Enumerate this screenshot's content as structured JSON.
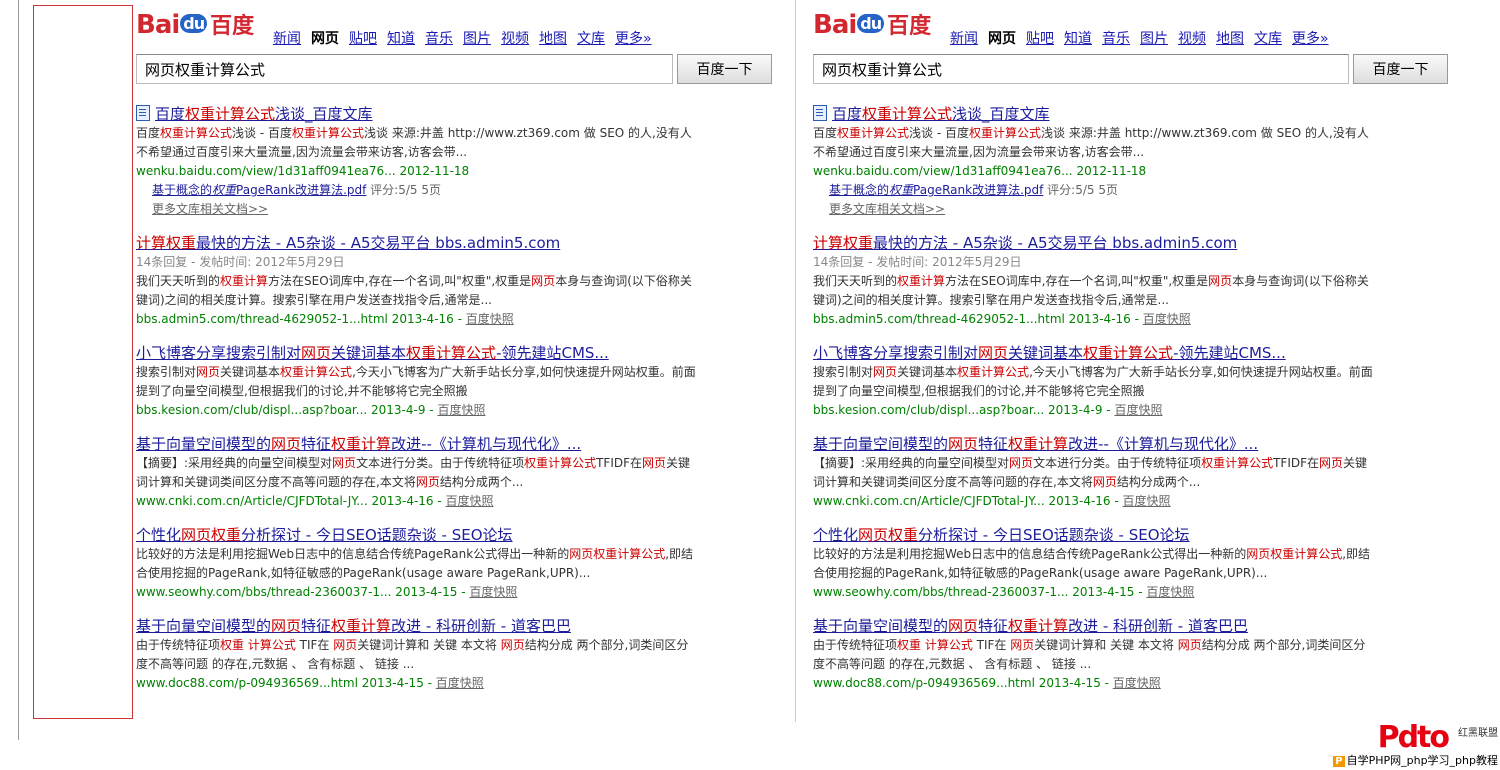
{
  "logo": {
    "bai": "Bai",
    "du": "du",
    "cn": "百度"
  },
  "nav": [
    "新闻",
    "网页",
    "贴吧",
    "知道",
    "音乐",
    "图片",
    "视频",
    "地图",
    "文库",
    "更多»"
  ],
  "nav_current": 1,
  "search": {
    "query": "网页权重计算公式",
    "button": "百度一下"
  },
  "results": [
    {
      "title_html": "百度<em>权重计算公式</em>浅谈_百度文库",
      "has_doc_icon": true,
      "abstract_html": "百度<em>权重计算公式</em>浅谈 - 百度<em>权重计算公式</em>浅谈 来源:井盖 http://www.zt369.com 做 SEO 的人,没有人不希望通过百度引来大量流量,因为流量会带来访客,访客会带...",
      "url": "wenku.baidu.com/view/1d31aff0941ea76... 2012-11-18",
      "snapshot": "",
      "sub_link_html": "基于概念的<em>权重</em>PageRank改进算法.pdf",
      "sub_rating": " 评分:5/5 5页",
      "sub_more": "更多文库相关文档>>"
    },
    {
      "title_html": "<em>计算权重</em>最快的方法 - A5杂谈 - A5交易平台 bbs.admin5.com",
      "meta": "14条回复 - 发帖时间: 2012年5月29日",
      "abstract_html": "我们天天听到的<em>权重计算</em>方法在SEO词库中,存在一个名词,叫\"权重\",权重是<em>网页</em>本身与查询词(以下俗称关键词)之间的相关度计算。搜索引擎在用户发送查找指令后,通常是...",
      "url": "bbs.admin5.com/thread-4629052-1...html 2013-4-16 - ",
      "snapshot": "百度快照"
    },
    {
      "title_html": "小飞博客分享搜索引制对<em>网页</em>关键词基本<em>权重计算公式</em>-领先建站CMS...",
      "abstract_html": "搜索引制对<em>网页</em>关键词基本<em>权重计算公式</em>,今天小飞博客为广大新手站长分享,如何快速提升网站权重。前面提到了向量空间模型,但根据我们的讨论,并不能够将它完全照搬",
      "url": "bbs.kesion.com/club/displ...asp?boar... 2013-4-9 - ",
      "snapshot": "百度快照"
    },
    {
      "title_html": "基于向量空间模型的<em>网页</em>特征<em>权重计算</em>改进--《计算机与现代化》...",
      "abstract_html": "【摘要】:采用经典的向量空间模型对<em>网页</em>文本进行分类。由于传统特征项<em>权重计算公式</em>TFIDF在<em>网页</em>关键词计算和关键词类间区分度不高等问题的存在,本文将<em>网页</em>结构分成两个...",
      "url": "www.cnki.com.cn/Article/CJFDTotal-JY... 2013-4-16 - ",
      "snapshot": "百度快照"
    },
    {
      "title_html": "个性化<em>网页权重</em>分析探讨 - 今日SEO话题杂谈 - SEO论坛",
      "abstract_html": "比较好的方法是利用挖掘Web日志中的信息结合传统PageRank公式得出一种新的<em>网页权重计算公式</em>,即结合使用挖掘的PageRank,如特征敏感的PageRank(usage aware PageRank,UPR)...",
      "url": "www.seowhy.com/bbs/thread-2360037-1... 2013-4-15 - ",
      "snapshot": "百度快照"
    },
    {
      "title_html": "基于向量空间模型的<em>网页</em>特征<em>权重计算</em>改进 - 科研创新 - 道客巴巴",
      "abstract_html": "由于传统特征项<em>权重 计算公式</em> TIF在 <em>网页</em>关键词计算和 关键 本文将 <em>网页</em>结构分成 两个部分,词类间区分度不高等问题 的存在,元数据 、 含有标题 、 链接 ...",
      "url": "www.doc88.com/p-094936569...html 2013-4-15 - ",
      "snapshot": "百度快照"
    }
  ],
  "watermark": {
    "logo": "Pdto",
    "side": "红黑联盟",
    "text": "自学PHP网_php学习_php教程",
    "badge": "P"
  }
}
